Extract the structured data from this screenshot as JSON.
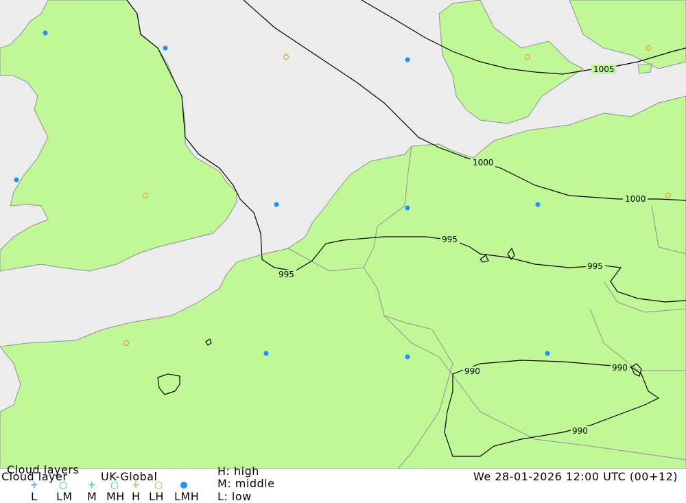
{
  "title": "Cloud layers",
  "subtitle_left": "Cloud layer",
  "model": "UK-Global",
  "datetime": "We 28-01-2026 12:00 UTC (00+12)",
  "legend": {
    "symbols": [
      {
        "label": "L",
        "icon": "plus-icon",
        "color": "#1e90ff"
      },
      {
        "label": "LM",
        "icon": "ring-icon",
        "color": "#1ec8c8"
      },
      {
        "label": "M",
        "icon": "plus-icon",
        "color": "#1ec8c8"
      },
      {
        "label": "MH",
        "icon": "ring-icon",
        "color": "#1ec8c8"
      },
      {
        "label": "H",
        "icon": "plus-icon",
        "color": "#e0a020"
      },
      {
        "label": "LH",
        "icon": "ring-icon",
        "color": "#e0a020"
      },
      {
        "label": "LMH",
        "icon": "filled-dot-icon",
        "color": "#1e90ff"
      }
    ],
    "key": {
      "high": "H: high",
      "middle": "M: middle",
      "low": "L: low"
    }
  },
  "isobars": [
    "1005",
    "1000",
    "1000",
    "995",
    "995",
    "995",
    "990",
    "990",
    "990"
  ],
  "colors": {
    "land": "#c0f898",
    "sea": "#ececec",
    "coast": "#909090",
    "isobar": "#000000",
    "lmh_marker": "#1e90ff",
    "lh_marker": "#e0a020"
  }
}
